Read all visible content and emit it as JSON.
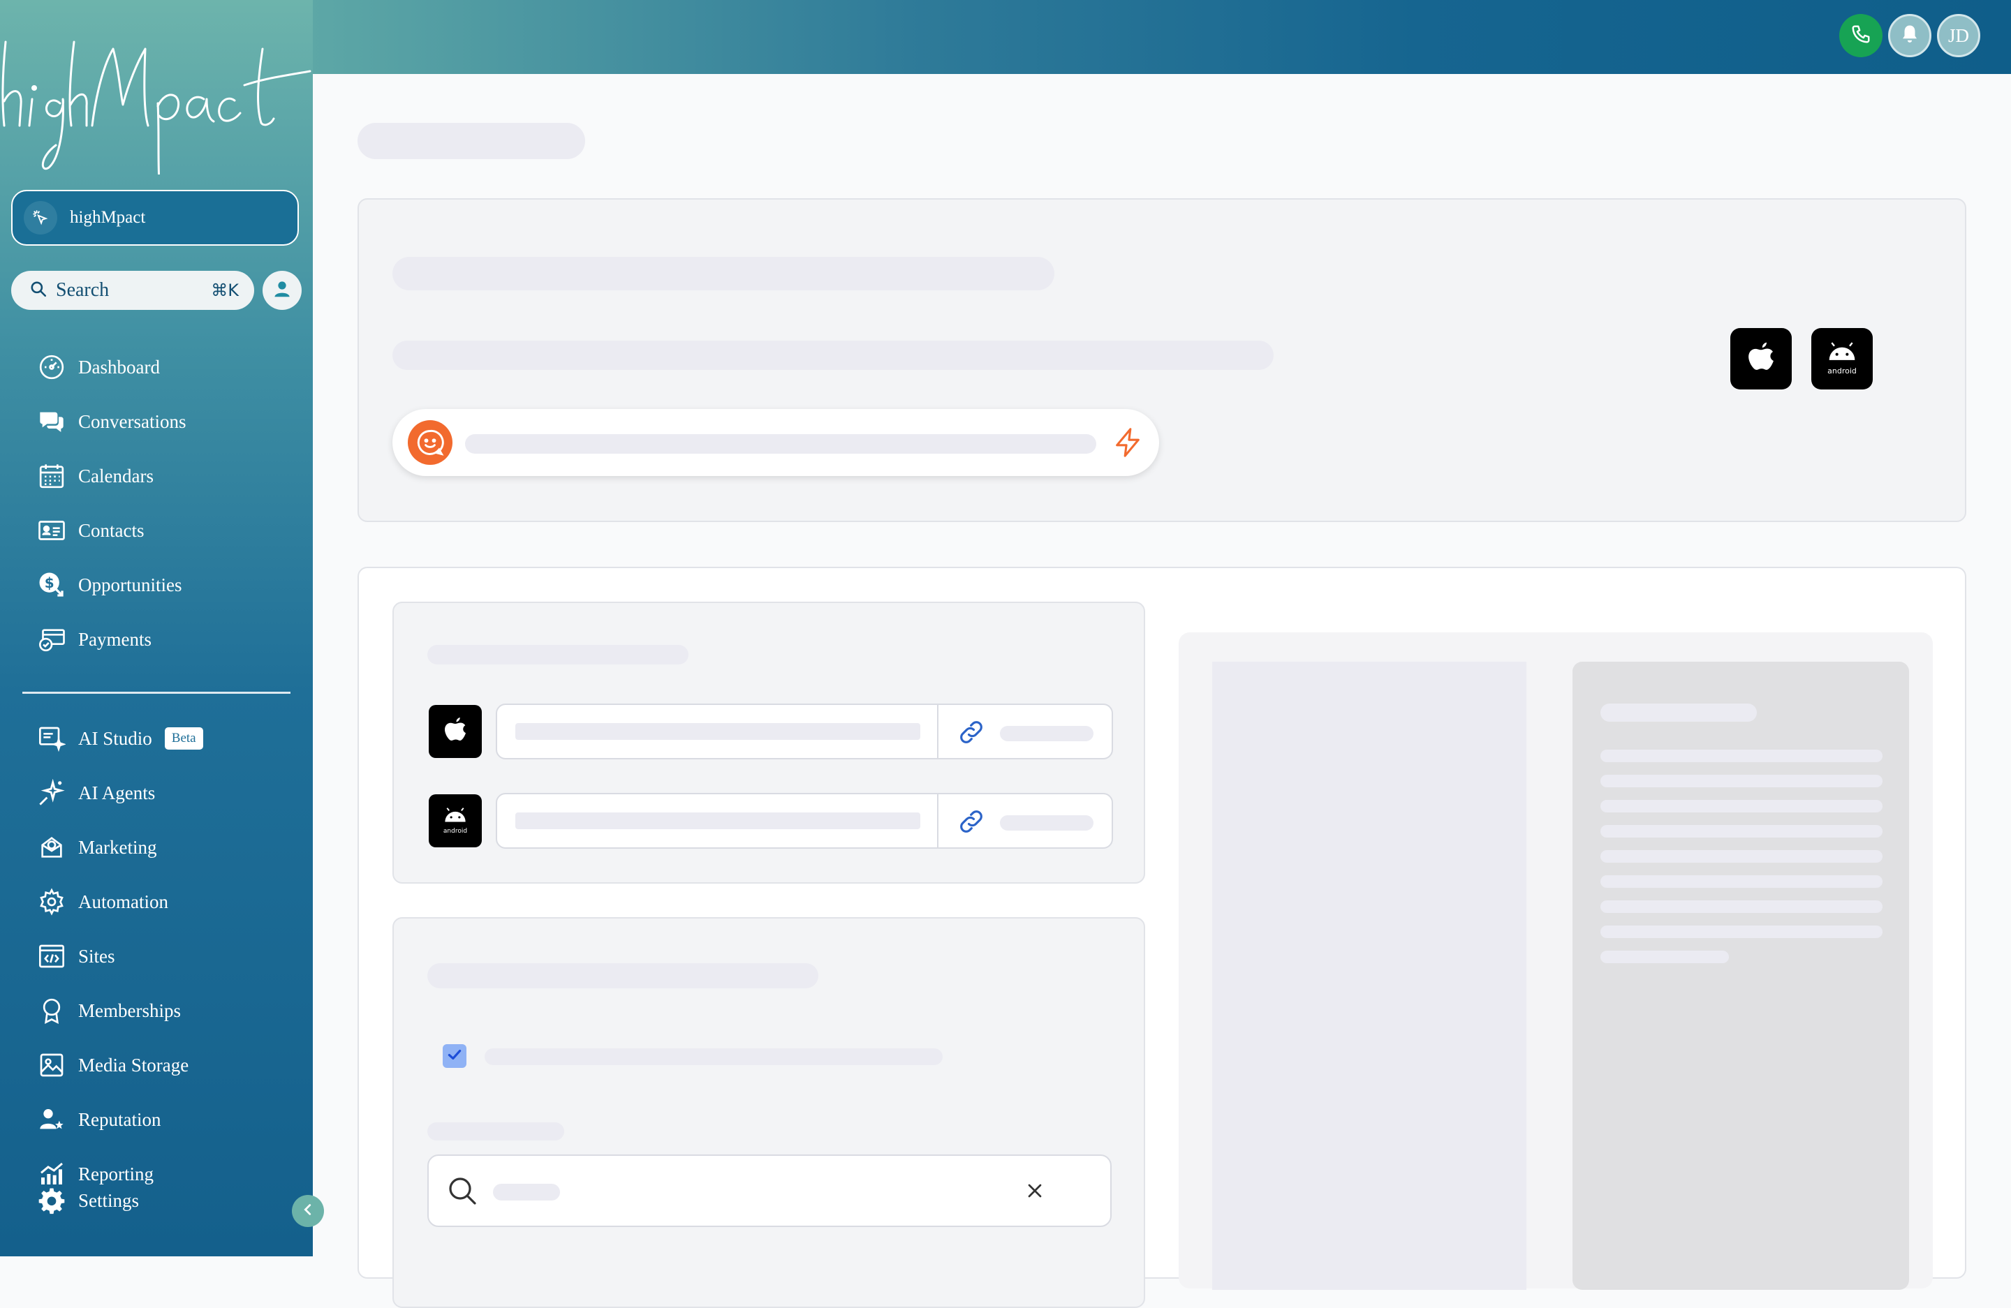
{
  "brand": {
    "logo_text": "highMpact"
  },
  "account": {
    "name": "highMpact"
  },
  "search": {
    "label": "Search",
    "shortcut": "⌘K"
  },
  "nav": {
    "primary": [
      {
        "label": "Dashboard",
        "icon": "dashboard-icon"
      },
      {
        "label": "Conversations",
        "icon": "chat-icon"
      },
      {
        "label": "Calendars",
        "icon": "calendar-icon"
      },
      {
        "label": "Contacts",
        "icon": "contacts-icon"
      },
      {
        "label": "Opportunities",
        "icon": "opportunities-icon"
      },
      {
        "label": "Payments",
        "icon": "payments-icon"
      }
    ],
    "secondary": [
      {
        "label": "AI Studio",
        "icon": "ai-studio-icon",
        "badge": "Beta"
      },
      {
        "label": "AI Agents",
        "icon": "sparkle-icon"
      },
      {
        "label": "Marketing",
        "icon": "marketing-icon"
      },
      {
        "label": "Automation",
        "icon": "automation-icon"
      },
      {
        "label": "Sites",
        "icon": "sites-icon"
      },
      {
        "label": "Memberships",
        "icon": "membership-icon"
      },
      {
        "label": "Media Storage",
        "icon": "media-icon"
      },
      {
        "label": "Reputation",
        "icon": "reputation-icon"
      },
      {
        "label": "Reporting",
        "icon": "reporting-icon"
      },
      {
        "label": "Settings",
        "icon": "settings-icon"
      }
    ]
  },
  "header": {
    "avatar_initials": "JD"
  },
  "badges": {
    "android_text": "android"
  },
  "colors": {
    "accent_orange": "#f26a2e",
    "phone_green": "#17a354",
    "link_blue": "#2b63c8",
    "checkbox_blue": "#8fb2f5"
  }
}
